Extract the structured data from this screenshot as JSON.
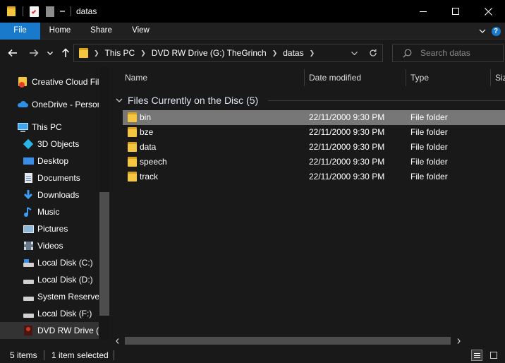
{
  "window": {
    "title": "datas",
    "minimize_label": "—",
    "maximize_label": "☐",
    "close_label": "✕"
  },
  "ribbon": {
    "tabs": [
      {
        "label": "File"
      },
      {
        "label": "Home"
      },
      {
        "label": "Share"
      },
      {
        "label": "View"
      }
    ],
    "collapse_glyph": "⌄",
    "help_glyph": "?"
  },
  "address": {
    "crumbs": [
      "This PC",
      "DVD RW Drive (G:) TheGrinch",
      "datas"
    ],
    "search_placeholder": "Search datas"
  },
  "nav_pane": {
    "items": [
      {
        "label": "Creative Cloud Files",
        "icon": "creative-cloud-icon"
      },
      {
        "label": "OneDrive - Personal",
        "icon": "onedrive-icon"
      },
      {
        "label": "This PC",
        "icon": "computer-icon"
      },
      {
        "label": "3D Objects",
        "icon": "cube-icon"
      },
      {
        "label": "Desktop",
        "icon": "desktop-icon"
      },
      {
        "label": "Documents",
        "icon": "document-icon"
      },
      {
        "label": "Downloads",
        "icon": "download-icon"
      },
      {
        "label": "Music",
        "icon": "music-icon"
      },
      {
        "label": "Pictures",
        "icon": "pictures-icon"
      },
      {
        "label": "Videos",
        "icon": "videos-icon"
      },
      {
        "label": "Local Disk (C:)",
        "icon": "drive-icon"
      },
      {
        "label": "Local Disk (D:)",
        "icon": "drive-icon"
      },
      {
        "label": "System Reserved (E:)",
        "icon": "drive-icon"
      },
      {
        "label": "Local Disk (F:)",
        "icon": "drive-icon"
      },
      {
        "label": "DVD RW Drive (G:) TheGrinch",
        "icon": "dvd-drive-icon"
      }
    ]
  },
  "columns": {
    "name": "Name",
    "date_modified": "Date modified",
    "type": "Type",
    "size": "Size"
  },
  "group": {
    "title": "Files Currently on the Disc (5)"
  },
  "files": [
    {
      "name": "bin",
      "date": "22/11/2000 9:30 PM",
      "type": "File folder"
    },
    {
      "name": "bze",
      "date": "22/11/2000 9:30 PM",
      "type": "File folder"
    },
    {
      "name": "data",
      "date": "22/11/2000 9:30 PM",
      "type": "File folder"
    },
    {
      "name": "speech",
      "date": "22/11/2000 9:30 PM",
      "type": "File folder"
    },
    {
      "name": "track",
      "date": "22/11/2000 9:30 PM",
      "type": "File folder"
    }
  ],
  "status": {
    "item_count": "5 items",
    "selection": "1 item selected"
  },
  "colors": {
    "accent": "#1979ca",
    "folder": "#f4c541",
    "background": "#191919"
  }
}
